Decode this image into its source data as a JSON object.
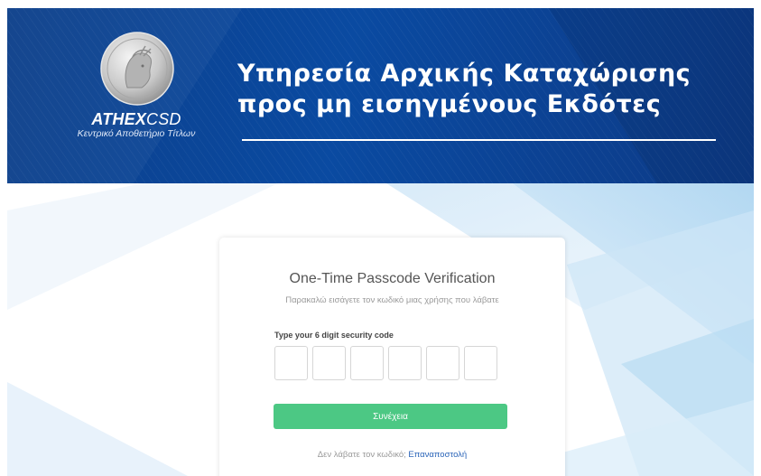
{
  "header": {
    "brand_bold": "ATHEX",
    "brand_light": "CSD",
    "brand_subtitle": "Κεντρικό Αποθετήριο Τίτλων",
    "title_line1": "Υπηρεσία Αρχικής Καταχώρισης",
    "title_line2": "προς μη εισηγμένους Εκδότες"
  },
  "otp": {
    "title": "One-Time Passcode Verification",
    "subtitle": "Παρακαλώ εισάγετε τον κωδικό μιας χρήσης που λάβατε",
    "code_label": "Type your 6 digit security code",
    "digits": [
      "",
      "",
      "",
      "",
      "",
      ""
    ],
    "continue_label": "Συνέχεια",
    "resend_prompt": "Δεν λάβατε τον κωδικό;",
    "resend_link": "Επαναποστολή"
  },
  "colors": {
    "banner": "#0a4aa1",
    "button": "#4cc884",
    "link": "#2a64b8"
  }
}
